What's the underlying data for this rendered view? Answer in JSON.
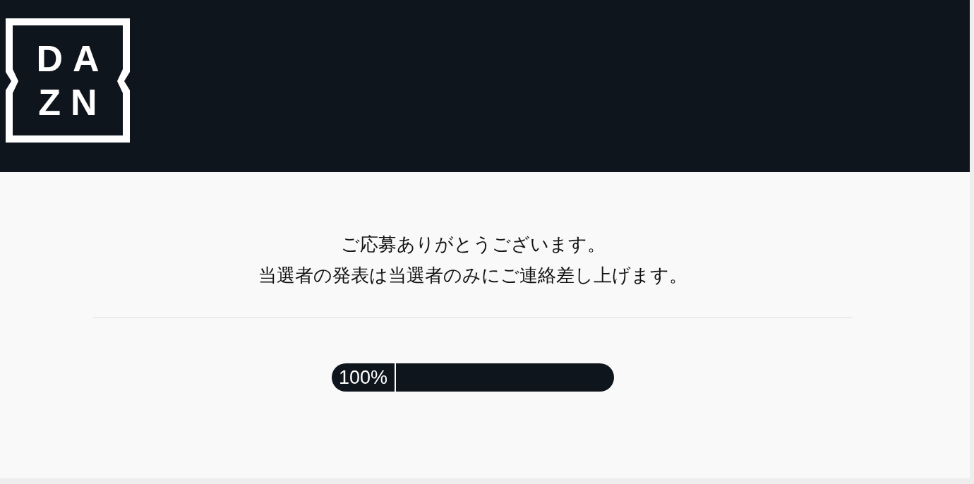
{
  "logo": {
    "lines": [
      "DA",
      "ZN"
    ]
  },
  "message": {
    "lines": [
      "ご応募ありがとうございます。",
      "当選者の発表は当選者のみにご連絡差し上げます。"
    ]
  },
  "progress": {
    "label": "100%"
  }
}
